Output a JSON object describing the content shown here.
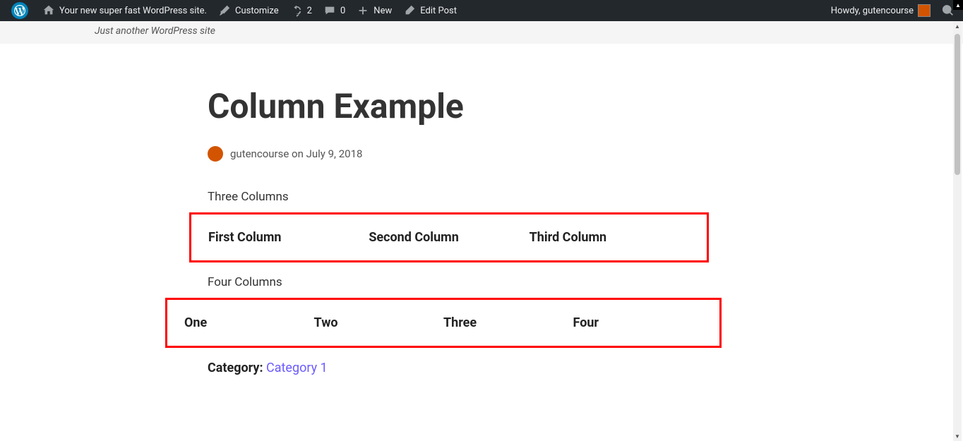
{
  "adminbar": {
    "site_name": "Your new super fast WordPress site.",
    "customize": "Customize",
    "updates_count": "2",
    "comments_count": "0",
    "new_label": "New",
    "edit_post": "Edit Post",
    "howdy": "Howdy, gutencourse"
  },
  "tagline": "Just another WordPress site",
  "post": {
    "title": "Column Example",
    "author": "gutencourse",
    "date_prefix": "on",
    "date": "July 9, 2018",
    "section1_label": "Three Columns",
    "three_cols": [
      "First Column",
      "Second Column",
      "Third Column"
    ],
    "section2_label": "Four Columns",
    "four_cols": [
      "One",
      "Two",
      "Three",
      "Four"
    ],
    "category_label": "Category:",
    "category_value": "Category 1"
  }
}
